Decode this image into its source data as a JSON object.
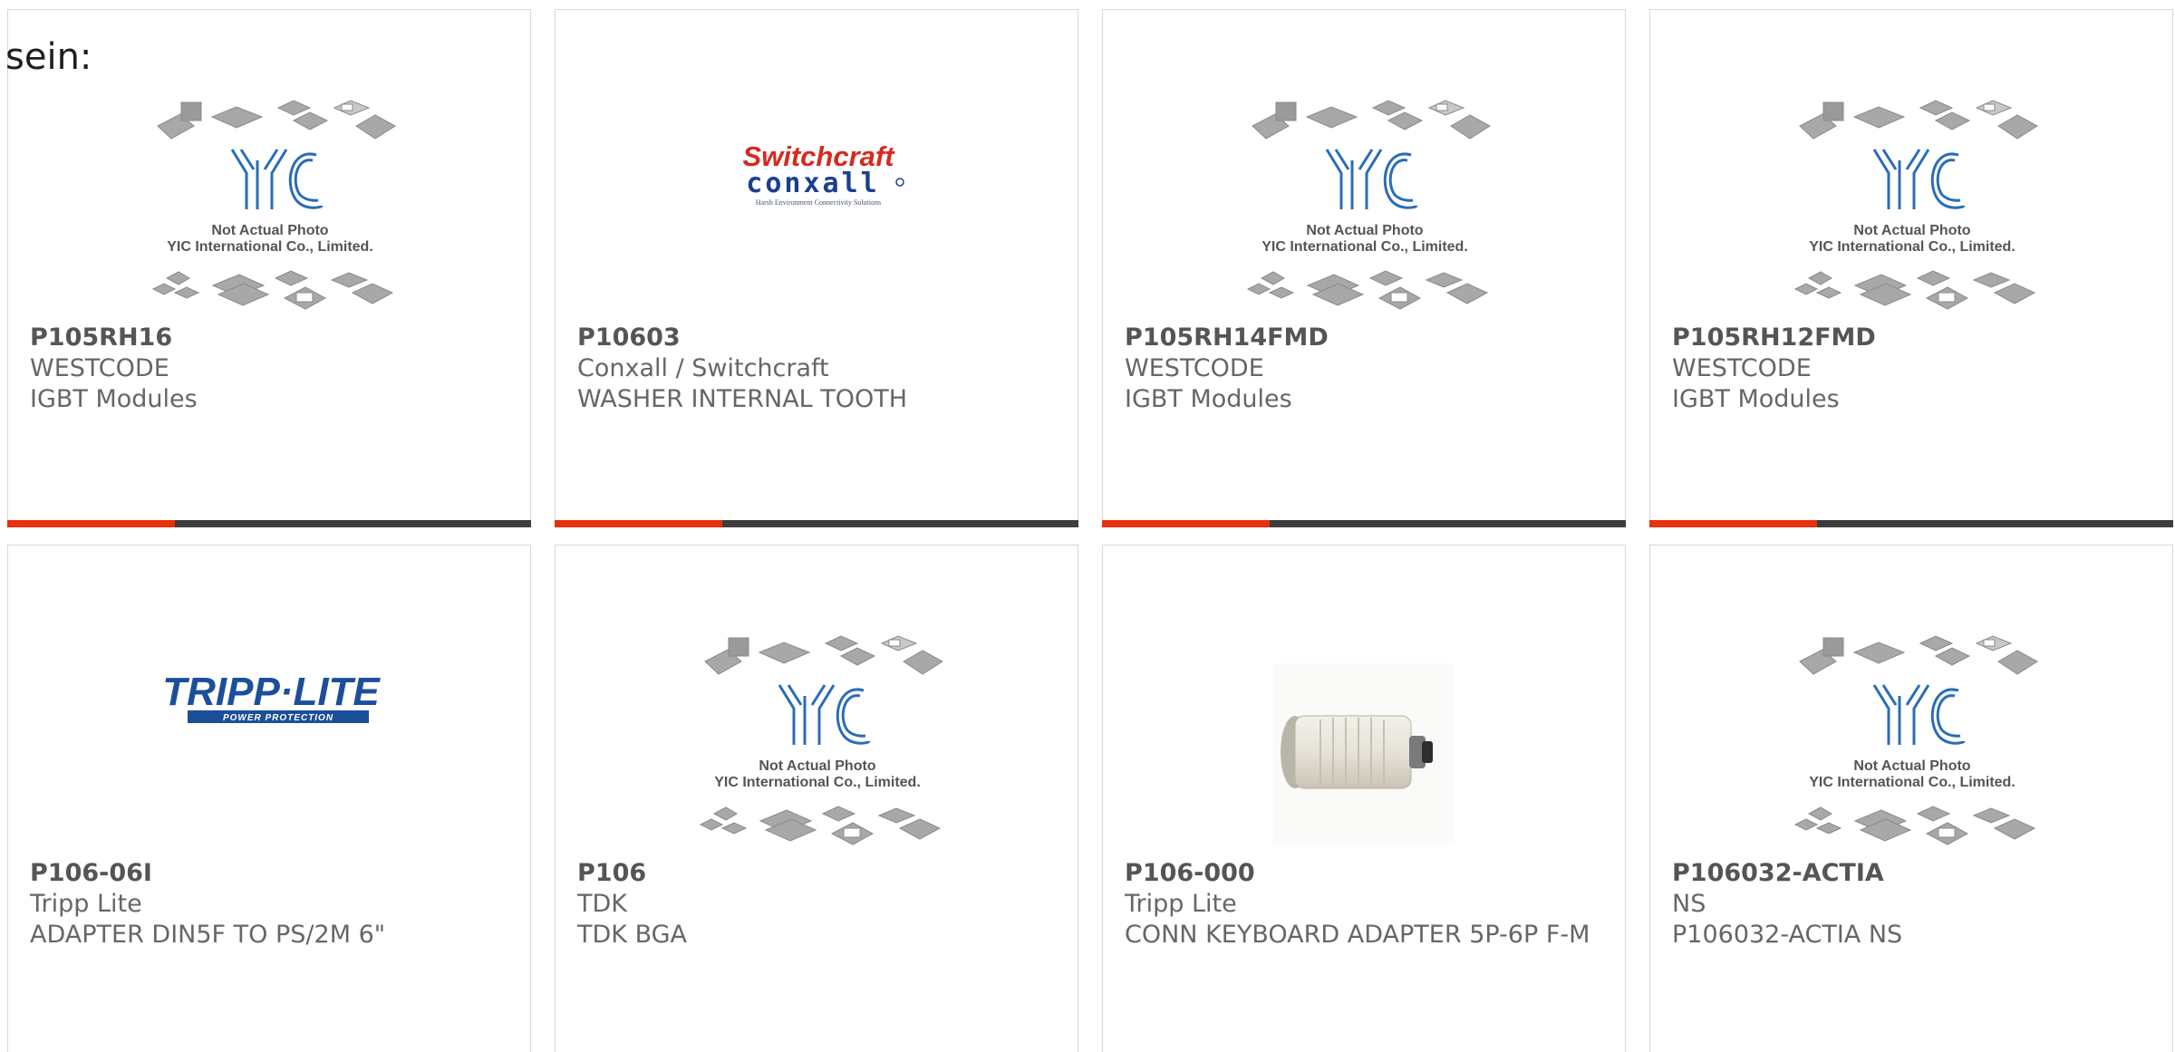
{
  "intro_text": "sein:",
  "colors": {
    "accent": "#e8300b",
    "bar_track": "#3d3d3d",
    "border": "#d8d8d8",
    "part_number": "#555555",
    "text": "#666666"
  },
  "placeholder_image": {
    "line1": "Not Actual Photo",
    "line2": "YIC International Co., Limited.",
    "logo": "YIC"
  },
  "logos": {
    "switchcraft": {
      "top": "Switchcraft",
      "bottom": "conxall",
      "tagline": "Harsh Environment Connectivity Solutions"
    },
    "tripplite": {
      "main": "TRIPP·LITE",
      "tagline": "POWER PROTECTION"
    }
  },
  "products": [
    {
      "part_number": "P105RH16",
      "manufacturer": "WESTCODE",
      "description": "IGBT Modules",
      "image": "yic-placeholder",
      "progress": 0.32
    },
    {
      "part_number": "P10603",
      "manufacturer": "Conxall / Switchcraft",
      "description": "WASHER INTERNAL TOOTH",
      "image": "switchcraft-logo",
      "progress": 0.32
    },
    {
      "part_number": "P105RH14FMD",
      "manufacturer": "WESTCODE",
      "description": "IGBT Modules",
      "image": "yic-placeholder",
      "progress": 0.32
    },
    {
      "part_number": "P105RH12FMD",
      "manufacturer": "WESTCODE",
      "description": "IGBT Modules",
      "image": "yic-placeholder",
      "progress": 0.32
    },
    {
      "part_number": "P106-06I",
      "manufacturer": "Tripp Lite",
      "description": "ADAPTER DIN5F TO PS/2M 6\"",
      "image": "tripplite-logo",
      "progress": 0.32
    },
    {
      "part_number": "P106",
      "manufacturer": "TDK",
      "description": "TDK BGA",
      "image": "yic-placeholder",
      "progress": 0.32
    },
    {
      "part_number": "P106-000",
      "manufacturer": "Tripp Lite",
      "description": "CONN KEYBOARD ADAPTER 5P-6P F-M",
      "image": "keyboard-adapter-photo",
      "progress": 0.32
    },
    {
      "part_number": "P106032-ACTIA",
      "manufacturer": "NS",
      "description": "P106032-ACTIA NS",
      "image": "yic-placeholder",
      "progress": 0.32
    }
  ]
}
